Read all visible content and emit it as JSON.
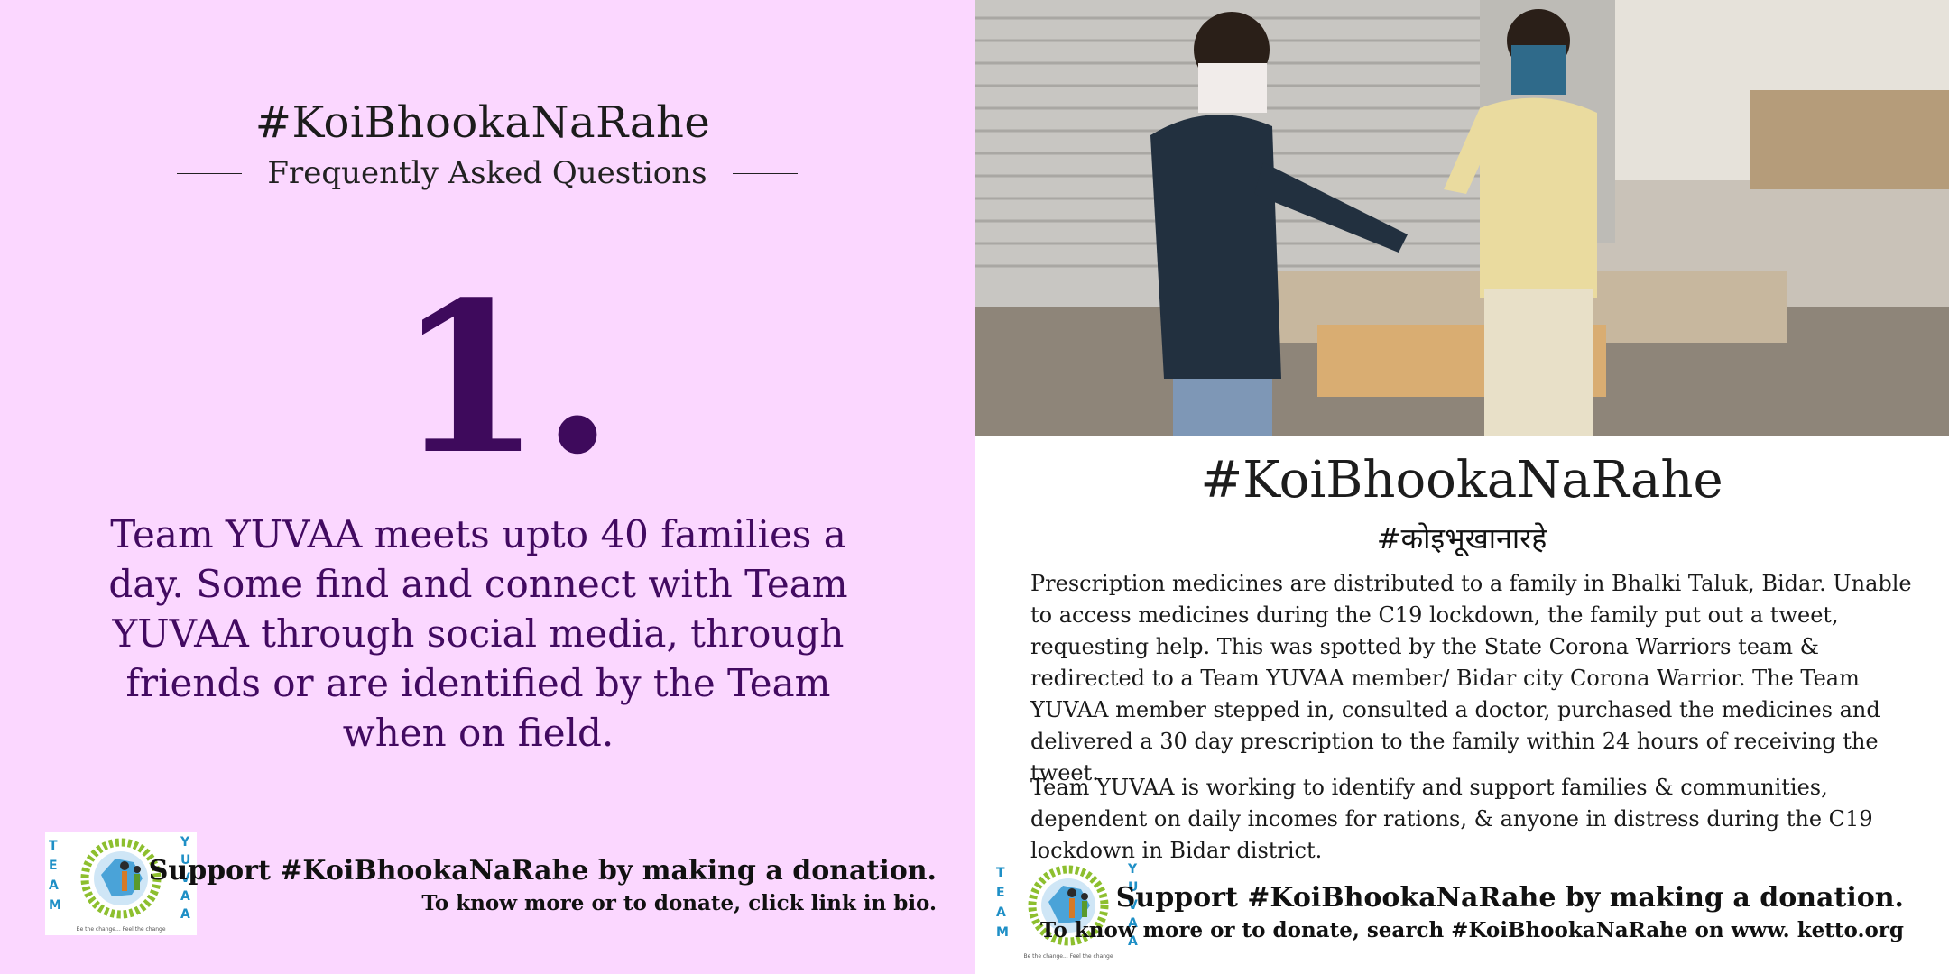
{
  "left": {
    "hashtag": "#KoiBhookaNaRahe",
    "subtitle": "Frequently Asked Questions",
    "number": "1.",
    "statement": "Team YUVAA meets upto 40 families a day. Some find and connect with Team YUVAA through social media, through friends or are identified by the Team when on field.",
    "support_main": "Support #KoiBhookaNaRahe by making a donation.",
    "support_sub": "To know more or to donate, click link in bio."
  },
  "right": {
    "hashtag": "#KoiBhookaNaRahe",
    "hashtag_hindi": "#कोइभूखानारहे",
    "paragraph_1": "Prescription medicines are distributed to a family in Bhalki Taluk, Bidar. Unable to access medicines during the C19 lockdown, the family put out a tweet, requesting help. This was spotted by the State Corona Warriors team & redirected to a Team YUVAA member/ Bidar city Corona Warrior. The Team YUVAA member stepped in, consulted a doctor, purchased the medicines and delivered a 30 day prescription to the family within 24 hours of receiving the tweet.",
    "paragraph_2": "Team YUVAA is working to identify and support families & communities, dependent on daily incomes for rations, & anyone in distress during the C19 lockdown in Bidar district.",
    "support_main": "Support #KoiBhookaNaRahe by making a donation.",
    "support_sub": "To know more or to donate, search #KoiBhookaNaRahe on www. ketto.org"
  },
  "logo": {
    "team_letters": "TEAM",
    "yuvaa_letters": "YUVAA",
    "tagline": "Be the change... Feel the change"
  },
  "colors": {
    "left_background": "#fbd7ff",
    "accent_purple": "#420a61",
    "logo_green": "#7bb32e",
    "logo_blue": "#1e8fc6"
  }
}
